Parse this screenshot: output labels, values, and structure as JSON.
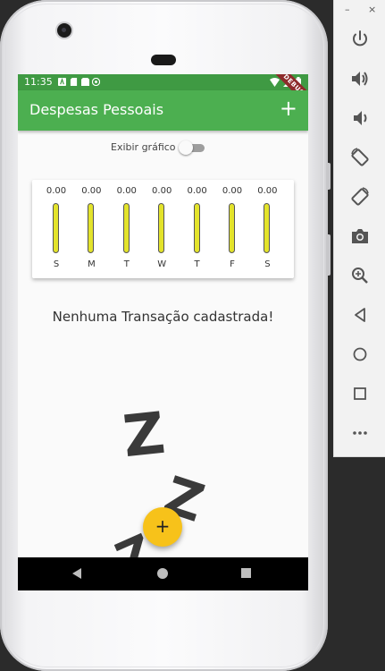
{
  "status_bar": {
    "time": "11:35",
    "debug_banner": "DEBUG"
  },
  "app_bar": {
    "title": "Despesas Pessoais",
    "add_icon": "+"
  },
  "toggle": {
    "label": "Exibir gráfico",
    "on": false
  },
  "chart_data": {
    "type": "bar",
    "categories": [
      "S",
      "M",
      "T",
      "W",
      "T",
      "F",
      "S"
    ],
    "values": [
      0,
      0,
      0,
      0,
      0,
      0,
      0
    ],
    "value_labels": [
      "0.00",
      "0.00",
      "0.00",
      "0.00",
      "0.00",
      "0.00",
      "0.00"
    ],
    "bar_color": "#e3e32b"
  },
  "empty_state": {
    "message": "Nenhuma Transação cadastrada!",
    "image_text": [
      "Z",
      "Z",
      "Z"
    ]
  },
  "fab": {
    "label": "+"
  },
  "emulator_panel": {
    "minimize": "–",
    "close": "×",
    "buttons": [
      "power-icon",
      "volume-up-icon",
      "volume-down-icon",
      "rotate-left-icon",
      "rotate-right-icon",
      "camera-icon",
      "zoom-icon",
      "back-icon",
      "home-icon",
      "overview-icon",
      "more-icon"
    ]
  },
  "colors": {
    "primary": "#4caf50",
    "status_bar": "#3f9a43",
    "fab": "#f7c21a"
  }
}
